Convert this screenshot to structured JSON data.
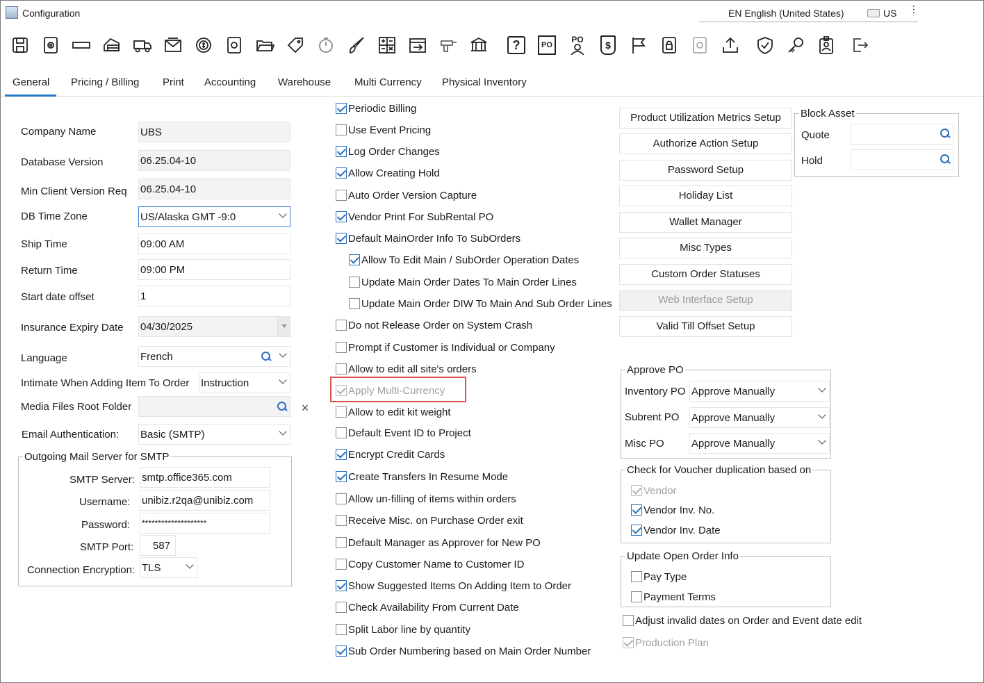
{
  "window": {
    "title": "Configuration"
  },
  "language_bar": {
    "language": "EN English (United States)",
    "keyboard": "US",
    "more": "⋮"
  },
  "toolbar": {
    "icons": [
      "save-icon",
      "settings-doc-icon",
      "rectangle-icon",
      "payment-icon",
      "truck-icon",
      "mail-icon",
      "money-gear-icon",
      "gear-doc-icon",
      "folder-open-icon",
      "tag-icon",
      "timer-icon",
      "brush-icon",
      "calculator-icon",
      "calendar-arrow-icon",
      "drill-icon",
      "bank-icon",
      "help-icon",
      "po-doc-icon",
      "po-user-icon",
      "money-doc-icon",
      "flag-icon",
      "lock-doc-icon",
      "gear-doc-light-icon",
      "upload-icon",
      "shield-icon",
      "key-icon",
      "id-badge-icon",
      "exit-icon"
    ],
    "help_label": "?",
    "po_label": "PO",
    "money_label": "$"
  },
  "tabs": [
    "General",
    "Pricing / Billing",
    "Print",
    "Accounting",
    "Warehouse",
    "Multi Currency",
    "Physical Inventory"
  ],
  "general": {
    "company_name_label": "Company Name",
    "company_name": "UBS",
    "db_version_label": "Database Version",
    "db_version": "06.25.04-10",
    "min_client_label": "Min Client Version Req",
    "min_client": "06.25.04-10",
    "tz_label": "DB Time Zone",
    "tz": "US/Alaska GMT -9:0",
    "ship_time_label": "Ship Time",
    "ship_time": "09:00 AM",
    "return_time_label": "Return Time",
    "return_time": "09:00 PM",
    "start_offset_label": "Start date offset",
    "start_offset": "1",
    "insurance_label": "Insurance Expiry Date",
    "insurance": "04/30/2025",
    "language_label": "Language",
    "language": "French",
    "intimate_label": "Intimate When Adding Item To Order",
    "intimate": "Instruction",
    "media_label": "Media Files Root Folder",
    "media": "",
    "email_auth_label": "Email Authentication:",
    "email_auth": "Basic (SMTP)",
    "clear_label": "×"
  },
  "smtp": {
    "legend": "Outgoing Mail Server for SMTP",
    "server_label": "SMTP Server:",
    "server": "smtp.office365.com",
    "username_label": "Username:",
    "username": "unibiz.r2qa@unibiz.com",
    "password_label": "Password:",
    "password": "********************",
    "port_label": "SMTP Port:",
    "port": "587",
    "enc_label": "Connection Encryption:",
    "enc": "TLS"
  },
  "options": [
    {
      "label": "Periodic Billing",
      "checked": true
    },
    {
      "label": "Use Event Pricing",
      "checked": false
    },
    {
      "label": "Log Order Changes",
      "checked": true
    },
    {
      "label": "Allow Creating Hold",
      "checked": true
    },
    {
      "label": "Auto Order Version Capture",
      "checked": false
    },
    {
      "label": "Vendor Print For SubRental PO",
      "checked": true
    },
    {
      "label": "Default MainOrder Info To SubOrders",
      "checked": true
    },
    {
      "label": "Allow To Edit Main / SubOrder Operation Dates",
      "checked": true
    },
    {
      "label": "Update Main Order Dates To Main Order Lines",
      "checked": false
    },
    {
      "label": "Update Main Order DIW To Main And Sub Order Lines",
      "checked": false
    },
    {
      "label": "Do not Release Order on System Crash",
      "checked": false
    },
    {
      "label": "Prompt if Customer is Individual or Company",
      "checked": false
    },
    {
      "label": "Allow to edit all site's orders",
      "checked": false
    },
    {
      "label": "Apply Multi-Currency",
      "checked": true,
      "disabled": true
    },
    {
      "label": "Allow to edit kit weight",
      "checked": false
    },
    {
      "label": "Default Event ID to Project",
      "checked": false
    },
    {
      "label": "Encrypt Credit Cards",
      "checked": true
    },
    {
      "label": "Create Transfers In Resume Mode",
      "checked": true
    },
    {
      "label": "Allow un-filling of items within orders",
      "checked": false
    },
    {
      "label": "Receive Misc. on Purchase Order exit",
      "checked": false
    },
    {
      "label": "Default Manager as Approver for New PO",
      "checked": false
    },
    {
      "label": "Copy Customer Name to Customer ID",
      "checked": false
    },
    {
      "label": "Show Suggested Items On Adding Item to Order",
      "checked": true
    },
    {
      "label": "Check Availability From Current Date",
      "checked": false
    },
    {
      "label": "Split Labor line by quantity",
      "checked": false
    },
    {
      "label": "Sub Order Numbering based on Main Order Number",
      "checked": true
    }
  ],
  "buttons": [
    {
      "label": "Product Utilization Metrics Setup",
      "disabled": false
    },
    {
      "label": "Authorize Action Setup",
      "disabled": false
    },
    {
      "label": "Password Setup",
      "disabled": false
    },
    {
      "label": "Holiday List",
      "disabled": false
    },
    {
      "label": "Wallet Manager",
      "disabled": false
    },
    {
      "label": "Misc Types",
      "disabled": false
    },
    {
      "label": "Custom Order Statuses",
      "disabled": false
    },
    {
      "label": "Web Interface Setup",
      "disabled": true
    },
    {
      "label": "Valid Till Offset Setup",
      "disabled": false
    }
  ],
  "block_asset": {
    "legend": "Block Asset",
    "quote_label": "Quote",
    "quote": "",
    "hold_label": "Hold",
    "hold": ""
  },
  "approve_po": {
    "legend": "Approve PO",
    "inventory_label": "Inventory PO",
    "inventory": "Approve Manually",
    "subrent_label": "Subrent PO",
    "subrent": "Approve Manually",
    "misc_label": "Misc PO",
    "misc": "Approve Manually"
  },
  "voucher": {
    "legend": "Check for Voucher duplication based on",
    "vendor": "Vendor",
    "vendor_inv_no": "Vendor Inv. No.",
    "vendor_inv_date": "Vendor Inv. Date"
  },
  "open_order": {
    "legend": "Update Open Order Info",
    "pay_type": "Pay Type",
    "payment_terms": "Payment Terms"
  },
  "adjust_dates": "Adjust invalid dates on Order and Event date edit",
  "production_plan": "Production Plan"
}
